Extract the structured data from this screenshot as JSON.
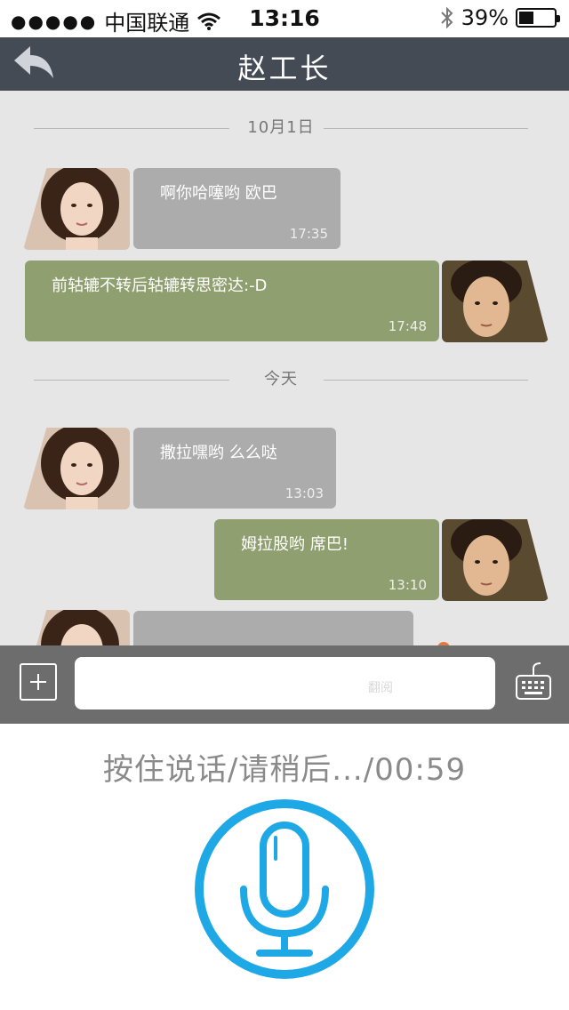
{
  "status_bar": {
    "carrier": "中国联通",
    "time": "13:16",
    "battery": "39%",
    "battery_level": 0.39
  },
  "nav": {
    "title": "赵工长"
  },
  "chat": {
    "separators": [
      {
        "label": "10月1日"
      },
      {
        "label": "今天"
      }
    ],
    "messages": [
      {
        "direction": "in",
        "text": "啊你哈噻哟 欧巴",
        "time": "17:35"
      },
      {
        "direction": "out",
        "text": "前轱辘不转后轱辘转思密达:-D",
        "time": "17:48"
      },
      {
        "direction": "in",
        "text": "撒拉嘿哟 么么哒",
        "time": "13:03"
      },
      {
        "direction": "out",
        "text": "姆拉股哟 席巴!",
        "time": "13:10"
      },
      {
        "direction": "in",
        "text": "",
        "time": ""
      }
    ]
  },
  "input_bar": {
    "hint": "翻阅"
  },
  "voice": {
    "prompt": "按住说话/请稍后.../00:59",
    "accent_color": "#1fa8e6"
  },
  "colors": {
    "nav_bg": "#444b55",
    "incoming_bubble": "#acacac",
    "outgoing_bubble": "#8f9f70"
  }
}
